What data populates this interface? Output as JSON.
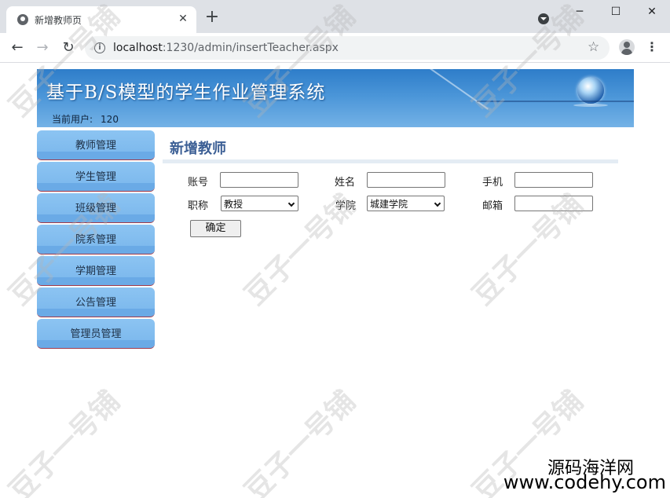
{
  "browser": {
    "tab_title": "新增教师页",
    "tab_close": "✕",
    "new_tab": "+",
    "url_host": "localhost",
    "url_path": ":1230/admin/insertTeacher.aspx",
    "icons": [
      "globe-icon",
      "close-icon",
      "plus-icon",
      "back-icon",
      "forward-icon",
      "reload-icon",
      "info-icon",
      "star-icon",
      "profile-icon",
      "more-vert-icon"
    ],
    "window_min": "─",
    "window_max": "☐",
    "window_close": "✕"
  },
  "header": {
    "title": "基于B/S模型的学生作业管理系统",
    "user_label": "当前用户:",
    "user_value": "120"
  },
  "sidebar": {
    "items": [
      {
        "label": "教师管理"
      },
      {
        "label": "学生管理"
      },
      {
        "label": "班级管理"
      },
      {
        "label": "院系管理"
      },
      {
        "label": "学期管理"
      },
      {
        "label": "公告管理"
      },
      {
        "label": "管理员管理"
      }
    ]
  },
  "main": {
    "title": "新增教师",
    "form": {
      "account_label": "账号",
      "account_value": "",
      "name_label": "姓名",
      "name_value": "",
      "phone_label": "手机",
      "phone_value": "",
      "title_label": "职称",
      "title_selected": "教授",
      "college_label": "学院",
      "college_selected": "城建学院",
      "email_label": "邮箱",
      "email_value": "",
      "confirm_label": "确定"
    }
  },
  "watermark": {
    "text": "豆子一号铺",
    "footer_line1": "源码海洋网",
    "footer_line2": "www.codehy.com"
  },
  "colors": {
    "header_blue": "#4a95d8",
    "nav_blue": "#79b6ec",
    "title_blue": "#3c5f95"
  }
}
